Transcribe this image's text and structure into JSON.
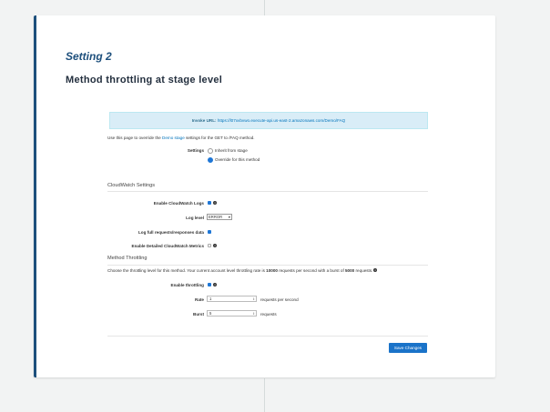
{
  "card": {
    "title": "Setting 2",
    "subtitle": "Method throttling at stage level"
  },
  "shot": {
    "invoke_label": "Invoke URL:",
    "invoke_url": "https://l07xvbvwo.execute-api.us-east-2.amazonaws.com/Demo/FAQ",
    "intro_pre": "Use this page to override the",
    "intro_link": "Demo stage",
    "intro_post": "settings for the GET to /FAQ method.",
    "settings_label": "Settings",
    "radio_inherit": "Inherit from stage",
    "radio_override": "Override for this method",
    "cloudwatch_heading": "CloudWatch Settings",
    "enable_logs_label": "Enable CloudWatch Logs",
    "log_level_label": "Log level",
    "log_level_value": "ERROR",
    "log_full_label": "Log full requests/responses data",
    "detailed_metrics_label": "Enable Detailed CloudWatch Metrics",
    "throttling_heading": "Method Throttling",
    "throttle_pre": "Choose the throttling level for this method. Your current account level throttling rate is",
    "throttle_rate": "10000",
    "throttle_mid": "requests per second with a burst of",
    "throttle_burst": "5000",
    "throttle_post": "requests.",
    "enable_throttling_label": "Enable throttling",
    "rate_label": "Rate",
    "rate_value": "1",
    "rate_unit": "requests per second",
    "burst_label": "Burst",
    "burst_value": "5",
    "burst_unit": "requests",
    "save_button": "Save Changes"
  },
  "colors": {
    "accent": "#1d4f7c",
    "button": "#1a73c9",
    "info_bg": "#d9edf7"
  }
}
